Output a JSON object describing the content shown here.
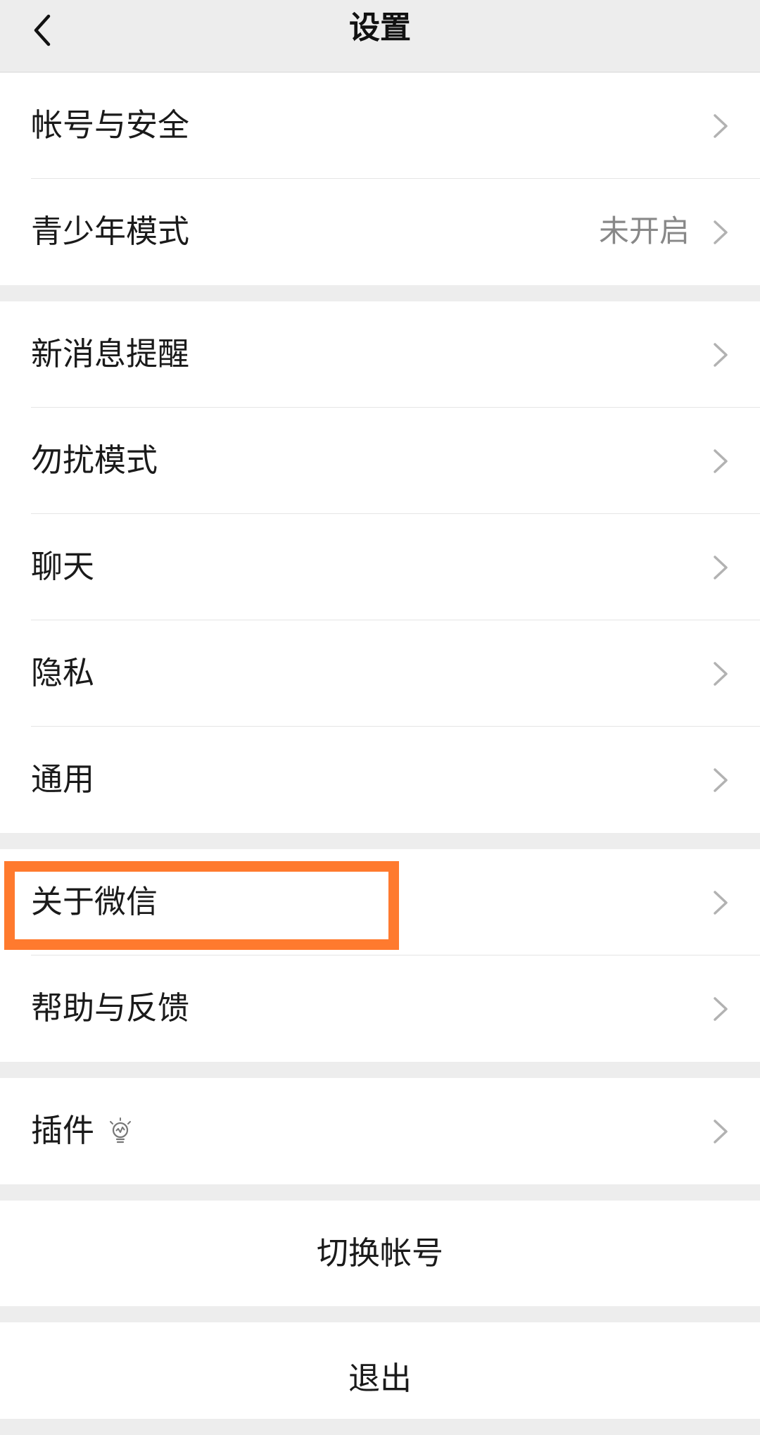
{
  "header": {
    "title": "设置",
    "back_icon": "chevron-left-icon"
  },
  "groups": [
    {
      "items": [
        {
          "label": "帐号与安全"
        },
        {
          "label": "青少年模式",
          "value": "未开启"
        }
      ]
    },
    {
      "items": [
        {
          "label": "新消息提醒"
        },
        {
          "label": "勿扰模式"
        },
        {
          "label": "聊天"
        },
        {
          "label": "隐私"
        },
        {
          "label": "通用"
        }
      ]
    },
    {
      "items": [
        {
          "label": "关于微信",
          "highlighted": true
        },
        {
          "label": "帮助与反馈"
        }
      ]
    },
    {
      "items": [
        {
          "label": "插件",
          "icon": "lightbulb-icon"
        }
      ]
    }
  ],
  "actions": {
    "switch_account": "切换帐号",
    "logout": "退出"
  },
  "colors": {
    "background": "#ededed",
    "highlight_border": "#ff7a2e",
    "chevron": "#b2b2b2",
    "secondary_text": "#888888"
  }
}
